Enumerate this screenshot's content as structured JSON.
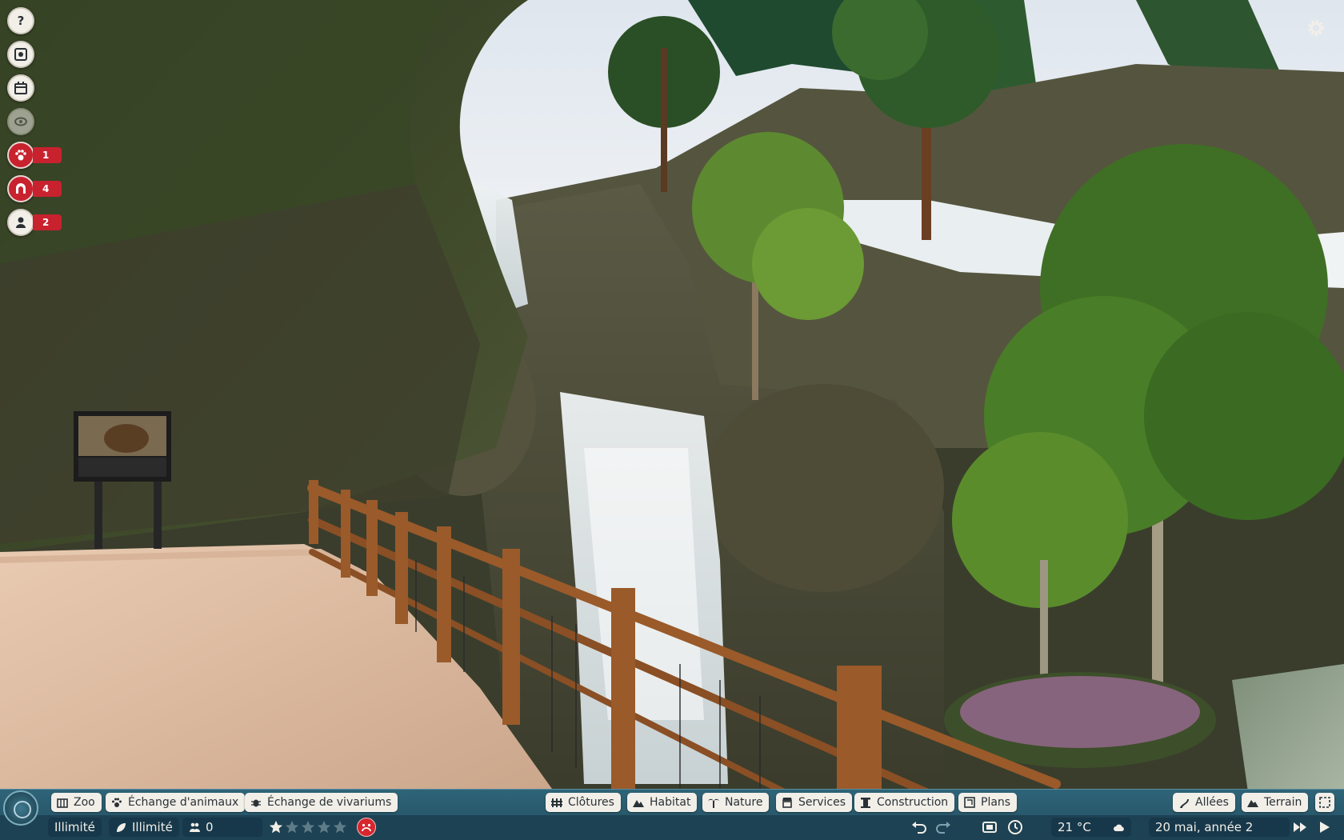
{
  "left_toolbar": {
    "animals_count": "1",
    "shelters_count": "4",
    "staff_count": "2"
  },
  "bottom_menu": {
    "zoo": "Zoo",
    "animal_exchange": "Échange d'animaux",
    "vivarium_exchange": "Échange de vivariums",
    "fences": "Clôtures",
    "habitat": "Habitat",
    "nature": "Nature",
    "services": "Services",
    "construction": "Construction",
    "plans": "Plans",
    "paths": "Allées",
    "terrain": "Terrain"
  },
  "status": {
    "money": "Illimité",
    "research": "Illimité",
    "guests": "0",
    "rating_stars": 1,
    "rating_max": 5,
    "temperature": "21 °C",
    "date": "20 mai, année 2"
  },
  "colors": {
    "bar_blue": "#2f6478",
    "alert_red": "#c8222f",
    "pill_bg": "#f2efe9"
  }
}
